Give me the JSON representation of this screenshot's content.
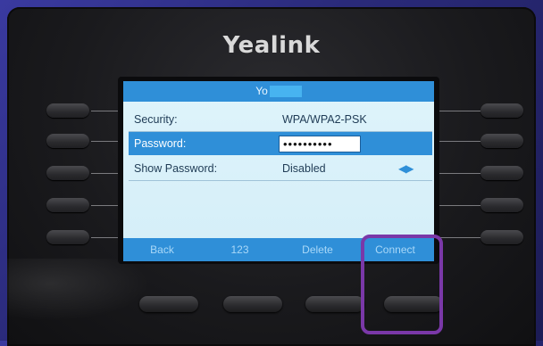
{
  "brand": "Yealink",
  "screen": {
    "title_visible": "Yo",
    "rows": [
      {
        "label": "Security:",
        "value": "WPA/WPA2-PSK"
      },
      {
        "label": "Password:",
        "value": "••••••••••"
      },
      {
        "label": "Show Password:",
        "value": "Disabled",
        "arrows": "◀▶"
      }
    ],
    "softkeys": [
      "Back",
      "123",
      "Delete",
      "Connect"
    ]
  },
  "colors": {
    "accent": "#2f8fd8",
    "highlight_box": "#7a38a8"
  }
}
